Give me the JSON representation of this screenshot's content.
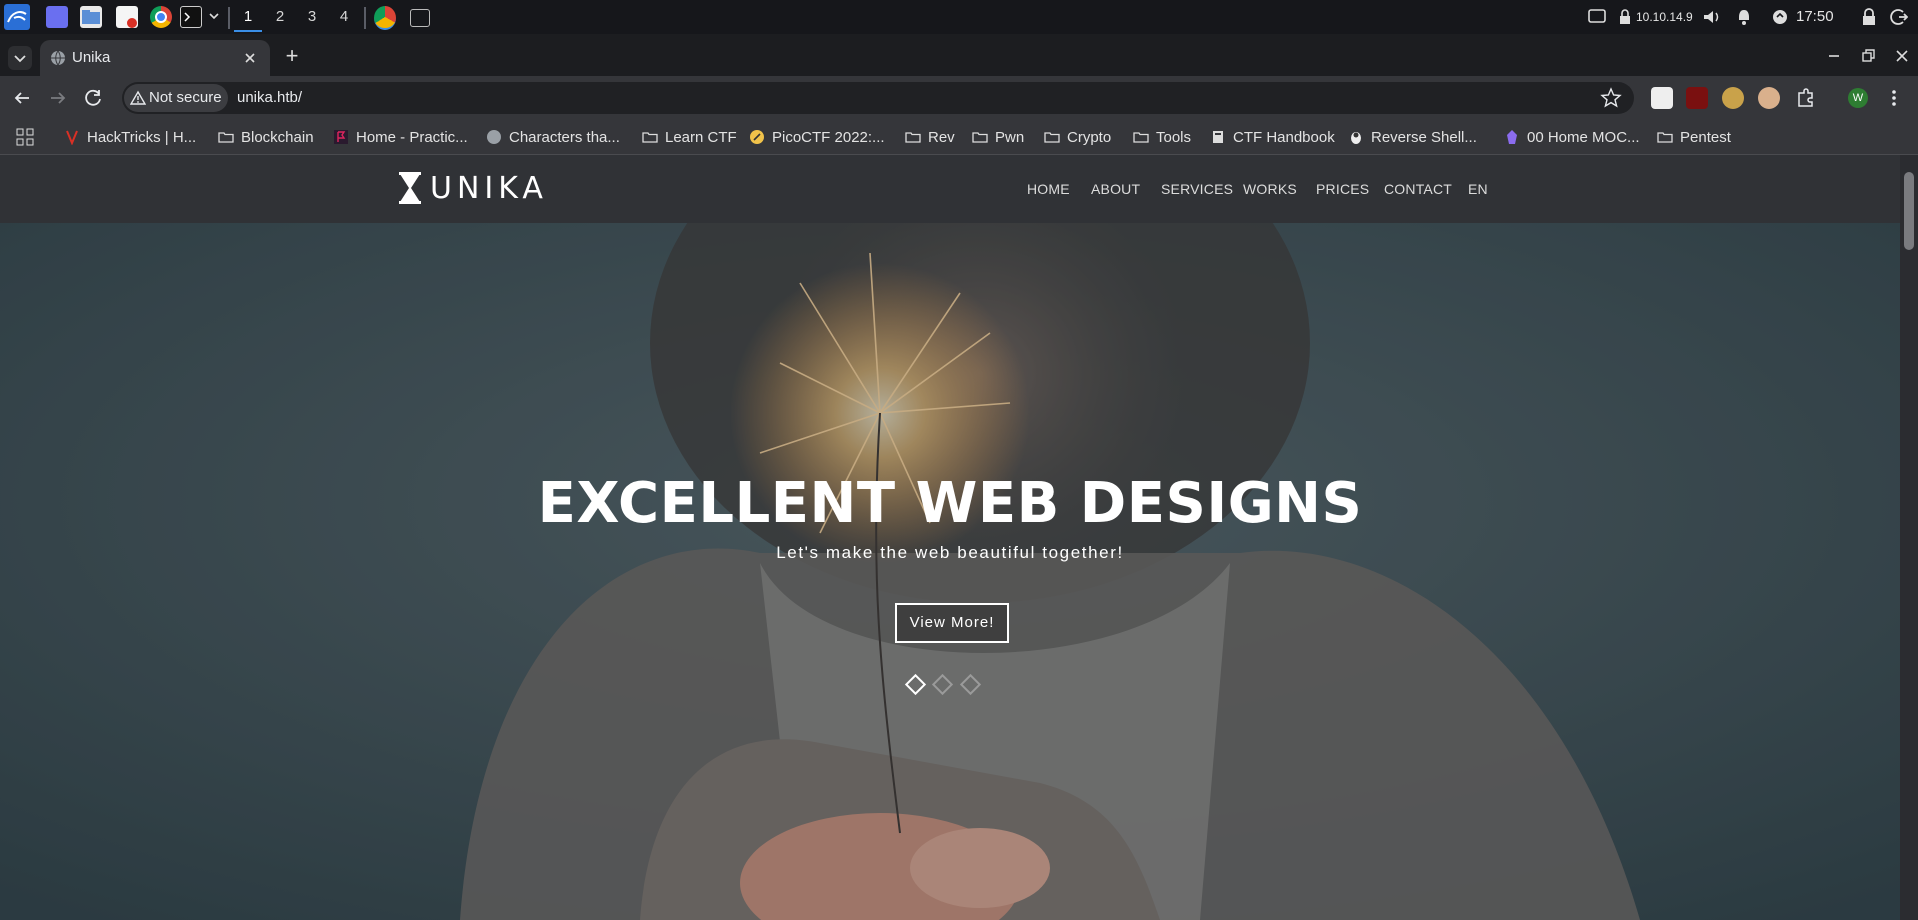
{
  "taskbar": {
    "workspaces": [
      "1",
      "2",
      "3",
      "4"
    ],
    "active_workspace": "1",
    "ip_address": "10.10.14.9",
    "clock": "17:50"
  },
  "browser": {
    "tab_title": "Unika",
    "new_tab_symbol": "+",
    "security_label": "Not secure",
    "url": "unika.htb/",
    "profile_initial": "W",
    "bookmarks": [
      "HackTricks | H...",
      "Blockchain",
      "Home - Practic...",
      "Characters tha...",
      "Learn CTF",
      "PicoCTF 2022:...",
      "Rev",
      "Pwn",
      "Crypto",
      "Tools",
      "CTF Handbook",
      "Reverse Shell...",
      "00 Home MOC...",
      "Pentest"
    ]
  },
  "site": {
    "logo_text": "UNIKA",
    "nav": [
      "HOME",
      "ABOUT",
      "SERVICES",
      "WORKS",
      "PRICES",
      "CONTACT",
      "EN"
    ],
    "hero_title": "EXCELLENT WEB DESIGNS",
    "hero_subtitle": "Let's make the web beautiful together!",
    "hero_button": "View More!",
    "slide_count": 3,
    "active_slide": 1
  },
  "colors": {
    "accent_blue": "#3a8ee6",
    "header_bg": "#303236",
    "hero_bg": "#3c4c52",
    "profile_green": "#2e7d32"
  }
}
